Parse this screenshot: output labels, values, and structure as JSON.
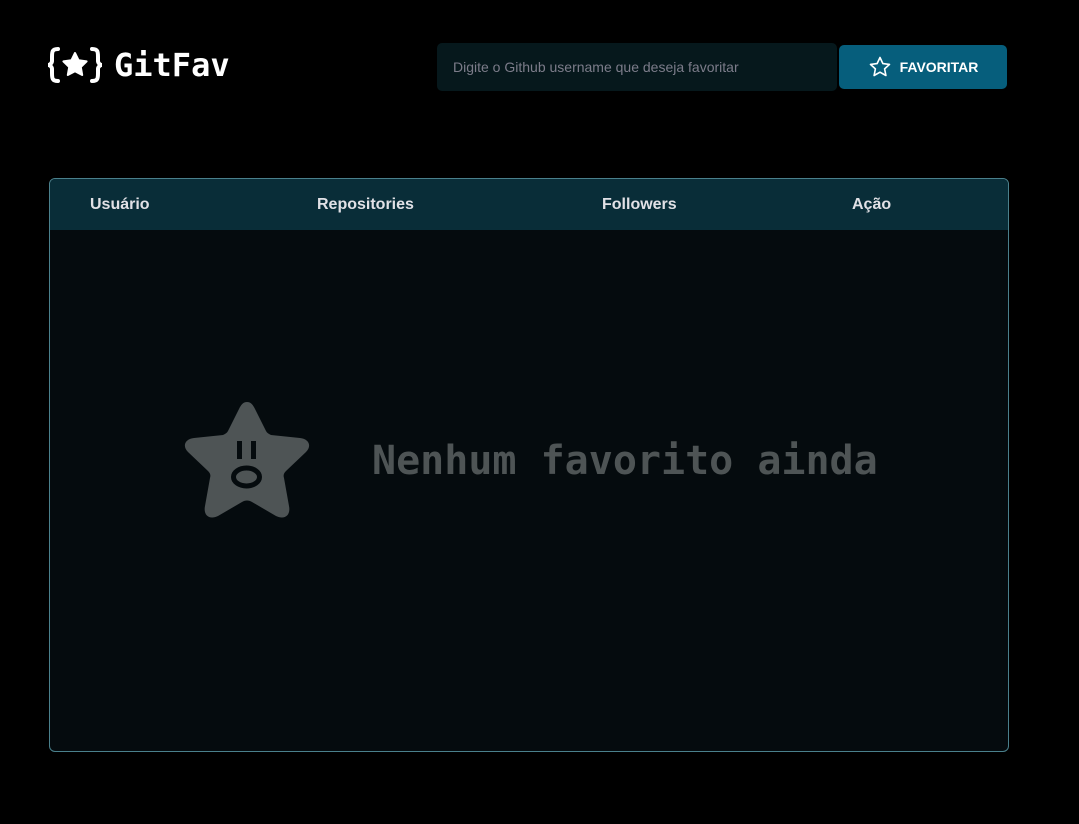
{
  "header": {
    "logo_icon": "star-braces-icon",
    "logo_text": "GitFav",
    "search": {
      "placeholder": "Digite o Github username que deseja favoritar",
      "value": ""
    },
    "favorite_button": {
      "icon": "star-outline-icon",
      "label": "FAVORITAR"
    }
  },
  "table": {
    "columns": [
      "Usuário",
      "Repositories",
      "Followers",
      "Ação"
    ],
    "rows": [],
    "empty_state": {
      "icon": "surprised-star-icon",
      "message": "Nenhum favorito ainda"
    }
  },
  "colors": {
    "background": "#000000",
    "table_header": "#092D38",
    "table_body": "#050B0E",
    "table_border": "#4A808C",
    "input_background": "#06181C",
    "button_background": "#065E7C",
    "empty_state": "#4E5455"
  }
}
